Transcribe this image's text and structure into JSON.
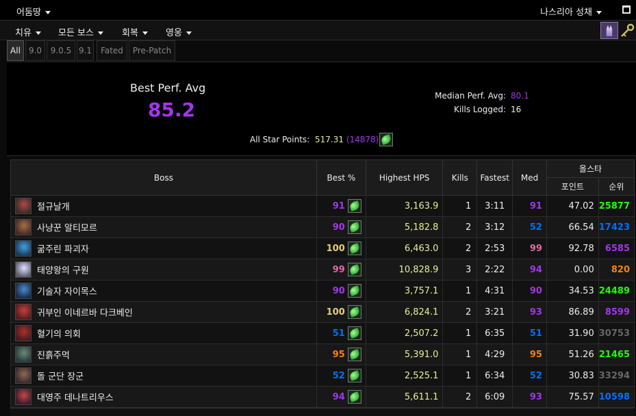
{
  "topbar": {
    "realm": "어둠땅",
    "zone": "나스리아 성채"
  },
  "menu": {
    "role": "치유",
    "bosses": "모든 보스",
    "metric": "회복",
    "difficulty": "영웅"
  },
  "patch_tabs": [
    "All",
    "9.0",
    "9.0.5",
    "9.1",
    "Fated",
    "Pre-Patch"
  ],
  "summary": {
    "best_label": "Best Perf. Avg",
    "best_value": "85.2",
    "median_label": "Median Perf. Avg:",
    "median_value": "80.1",
    "kills_label": "Kills Logged:",
    "kills_value": "16",
    "star_label": "All Star Points:",
    "star_points": "517.31",
    "star_rank": "(14878)"
  },
  "table": {
    "headers": {
      "boss": "Boss",
      "best": "Best %",
      "hps": "Highest HPS",
      "kills": "Kills",
      "fastest": "Fastest",
      "med": "Med",
      "allstar": "올스타",
      "points": "포인트",
      "rank": "순위"
    },
    "rows": [
      {
        "name": "절규날개",
        "best": "91",
        "hps": "3,163.9",
        "kills": "1",
        "fastest": "3:11",
        "med": "91",
        "points": "47.02",
        "rank": "25877"
      },
      {
        "name": "사냥꾼 알티모르",
        "best": "90",
        "hps": "5,182.8",
        "kills": "2",
        "fastest": "3:12",
        "med": "52",
        "points": "66.54",
        "rank": "17423"
      },
      {
        "name": "굶주린 파괴자",
        "best": "100",
        "hps": "6,463.0",
        "kills": "2",
        "fastest": "2:53",
        "med": "99",
        "points": "92.78",
        "rank": "6585"
      },
      {
        "name": "태양왕의 구원",
        "best": "99",
        "hps": "10,828.9",
        "kills": "3",
        "fastest": "2:22",
        "med": "94",
        "points": "0.00",
        "rank": "820"
      },
      {
        "name": "기술자 자이목스",
        "best": "90",
        "hps": "3,757.1",
        "kills": "1",
        "fastest": "4:31",
        "med": "90",
        "points": "34.53",
        "rank": "24489"
      },
      {
        "name": "귀부인 이네르바 다크베인",
        "best": "100",
        "hps": "6,824.1",
        "kills": "2",
        "fastest": "3:21",
        "med": "93",
        "points": "86.89",
        "rank": "8599"
      },
      {
        "name": "혈기의 의회",
        "best": "51",
        "hps": "2,507.2",
        "kills": "1",
        "fastest": "6:35",
        "med": "51",
        "points": "31.90",
        "rank": "30753"
      },
      {
        "name": "진흙주먹",
        "best": "95",
        "hps": "5,391.0",
        "kills": "1",
        "fastest": "4:29",
        "med": "95",
        "points": "51.26",
        "rank": "21465"
      },
      {
        "name": "돌 군단 장군",
        "best": "52",
        "hps": "2,525.1",
        "kills": "1",
        "fastest": "6:34",
        "med": "52",
        "points": "30.83",
        "rank": "33294"
      },
      {
        "name": "대영주 데나트리우스",
        "best": "94",
        "hps": "5,611.1",
        "kills": "2",
        "fastest": "6:09",
        "med": "93",
        "points": "75.57",
        "rank": "10598"
      }
    ]
  },
  "colors": {
    "artifact": "#e5cc80",
    "legendary": "#ff8000",
    "epic": "#a335ee",
    "rare": "#0070ff",
    "uncommon": "#1eff00",
    "common": "#666666",
    "pink": "#e268a8",
    "hps": "#e8f090"
  }
}
